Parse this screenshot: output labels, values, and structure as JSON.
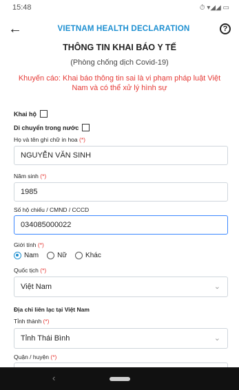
{
  "status_bar": {
    "time": "15:48",
    "icons": "⏱ ▾◢◢ ▭"
  },
  "header": {
    "back_icon": "←",
    "title": "VIETNAM HEALTH DECLARATION",
    "help_icon": "?"
  },
  "form": {
    "title": "THÔNG TIN KHAI BÁO Y TẾ",
    "subtitle": "(Phòng chống dịch Covid-19)",
    "warning": "Khuyến cáo: Khai báo thông tin sai là vi phạm pháp luật Việt Nam và có thể xử lý hình sự",
    "declare_for_others": "Khai hộ",
    "domestic_travel": "Di chuyển trong nước",
    "fields": {
      "fullname": {
        "label": "Họ và tên ghi chữ in hoa",
        "required": "(*)",
        "value": "NGUYỄN VĂN SINH"
      },
      "birth_year": {
        "label": "Năm sinh",
        "required": "(*)",
        "value": "1985"
      },
      "id_number": {
        "label": "Số hộ chiếu / CMND / CCCD",
        "value": "034085000022"
      },
      "gender": {
        "label": "Giới tính",
        "required": "(*)",
        "options": [
          "Nam",
          "Nữ",
          "Khác"
        ],
        "selected": "Nam"
      },
      "nationality": {
        "label": "Quốc tịch",
        "required": "(*)",
        "value": "Việt Nam"
      }
    },
    "contact_section": "Địa chỉ liên lạc tại Việt Nam",
    "province": {
      "label": "Tỉnh thành",
      "required": "(*)",
      "value": "Tỉnh Thái Bình"
    },
    "district": {
      "label": "Quận / huyện",
      "required": "(*)"
    }
  },
  "nav": {
    "back_glyph": "‹"
  },
  "colors": {
    "accent": "#1d8fd1",
    "required": "#e53935",
    "active_border": "#3a86ff"
  }
}
